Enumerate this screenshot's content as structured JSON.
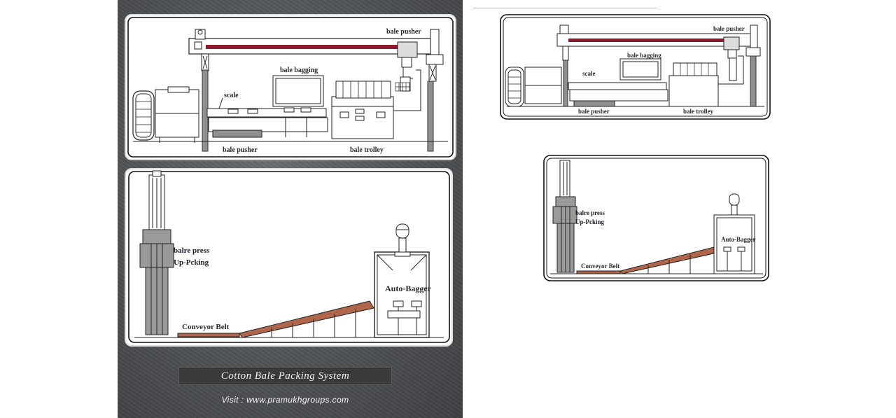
{
  "poster": {
    "title": "Cotton Bale Packing System",
    "visit": "Visit : www.pramukhgroups.com"
  },
  "labels": {
    "bale_pusher": "bale pusher",
    "bale_bagging": "bale bagging",
    "scale": "scale",
    "bale_trolley": "bale trolley",
    "balre_press": "balre press",
    "up_packing": "Up-Pcking",
    "conveyor_belt": "Conveyor Belt",
    "auto_bagger": "Auto-Bagger"
  },
  "colors": {
    "poster_bg": "#55585b",
    "rail": "#8b1a2b",
    "conveyor": "#b0664a",
    "line": "#222222"
  }
}
